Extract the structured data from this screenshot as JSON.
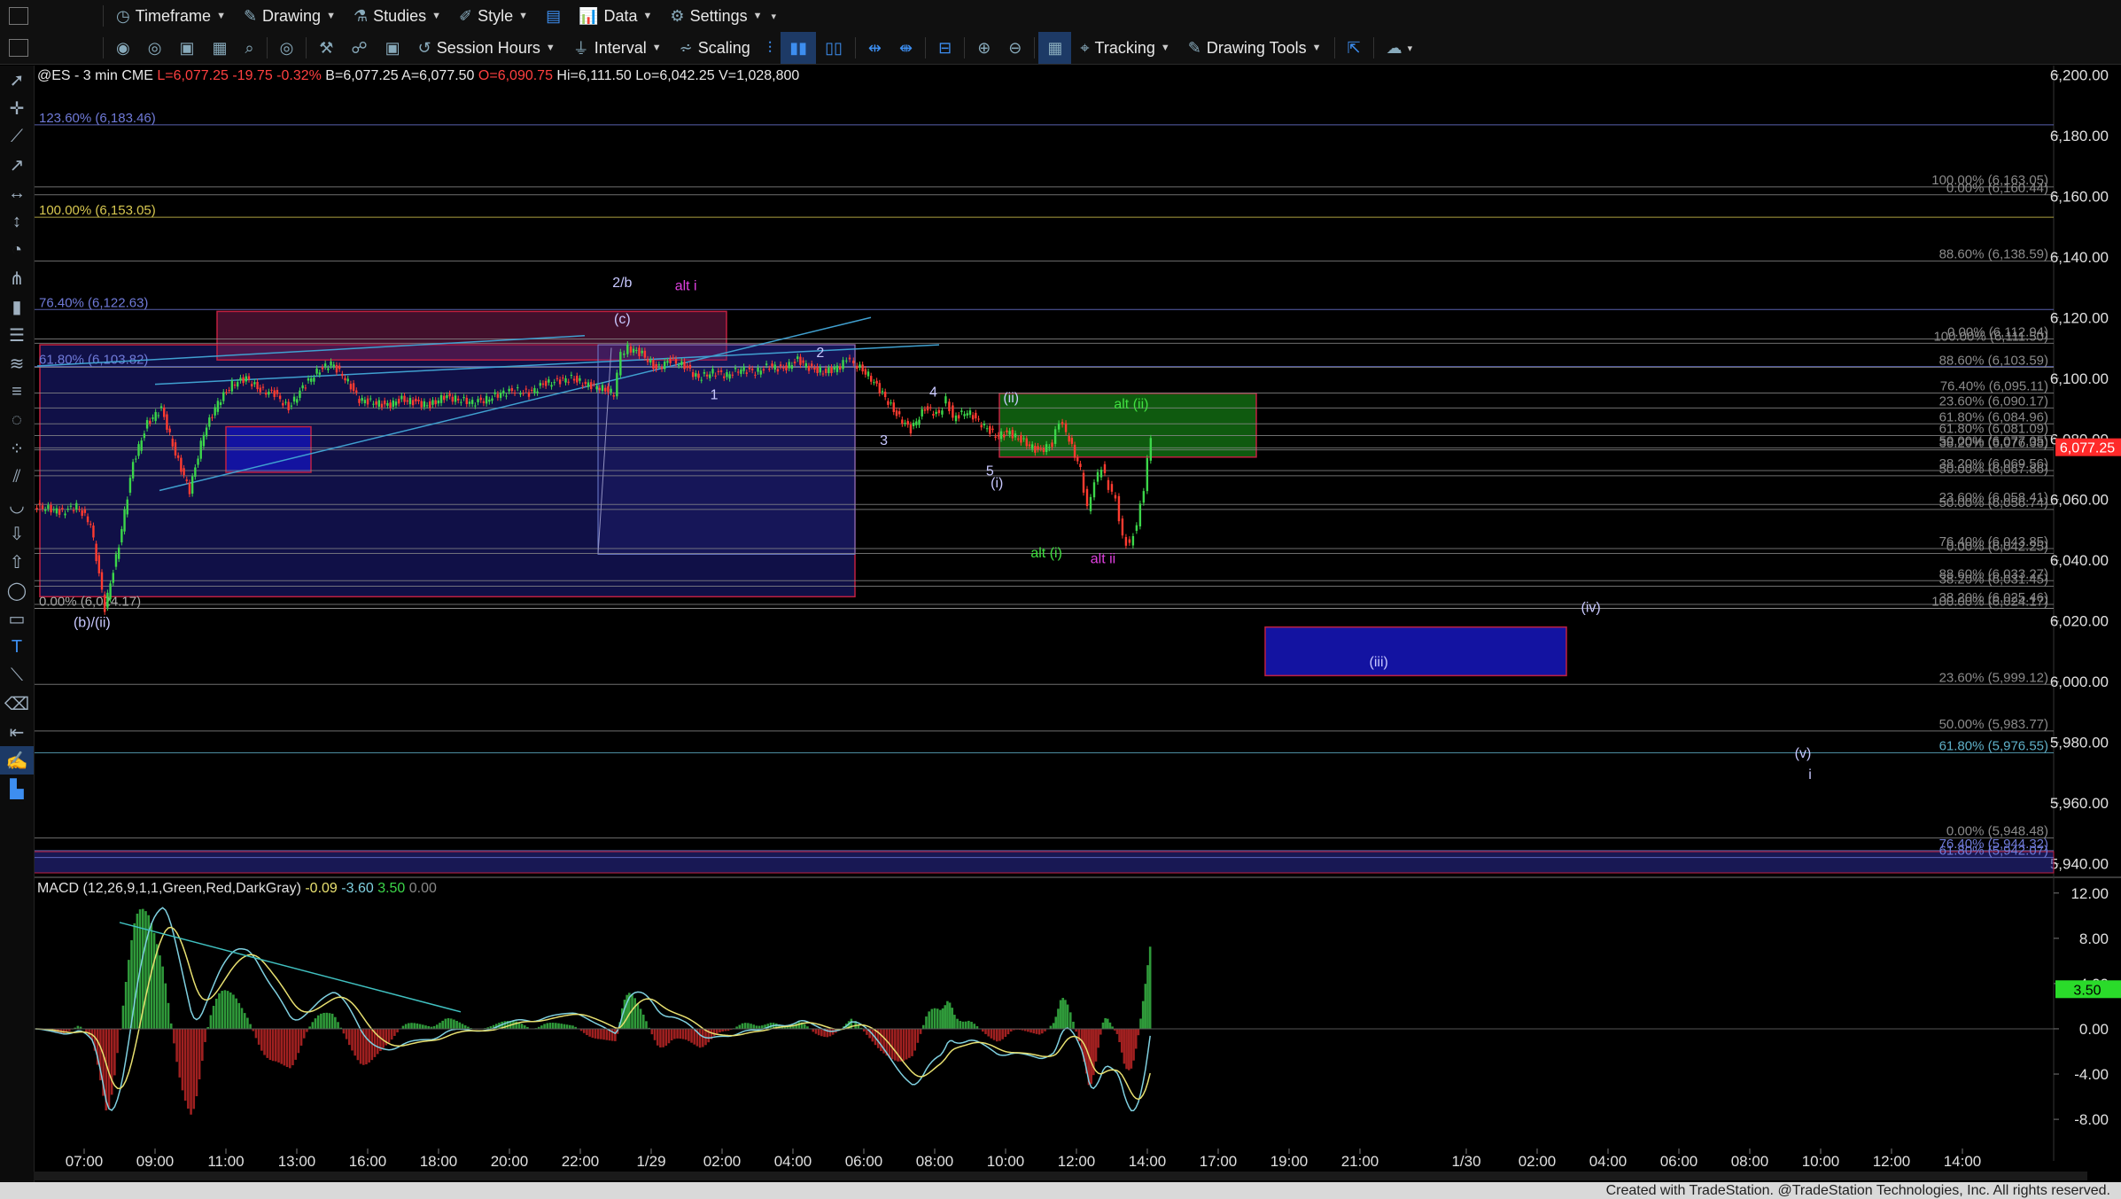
{
  "toolbar1": {
    "timeframe": "Timeframe",
    "drawing": "Drawing",
    "studies": "Studies",
    "style": "Style",
    "data": "Data",
    "settings": "Settings"
  },
  "toolbar2": {
    "session_hours": "Session Hours",
    "interval": "Interval",
    "scaling": "Scaling",
    "tracking": "Tracking",
    "drawing_tools": "Drawing Tools"
  },
  "quote": {
    "symbol": "@ES - 3 min",
    "exchange": "CME",
    "last": "L=6,077.25",
    "chg": "-19.75",
    "pct": "-0.32%",
    "bid": "B=6,077.25",
    "ask": "A=6,077.50",
    "open": "O=6,090.75",
    "high": "Hi=6,111.50",
    "low": "Lo=6,042.25",
    "vol": "V=1,028,800"
  },
  "macd_label": {
    "name": "MACD (12,26,9,1,1,Green,Red,DarkGray)",
    "v1": "-0.09",
    "v2": "-3.60",
    "v3": "3.50",
    "v4": "0.00"
  },
  "price_tag": "6,077.25",
  "macd_tag": "3.50",
  "footer": "Created with TradeStation. @TradeStation Technologies, Inc. All rights reserved.",
  "colors": {
    "background": "#000000",
    "up_candle": "#3cd64a",
    "down_candle": "#ff3b30",
    "price_tag": "#ff2a2a",
    "macd_line": "#7fd0e0",
    "signal_line": "#e8e070",
    "fib_blue": "#6f7ad8",
    "fib_gray": "#8a8a8a"
  },
  "chart_data": [
    {
      "type": "candlestick",
      "title": "@ES - 3 min",
      "x_ticks": [
        "07:00",
        "09:00",
        "11:00",
        "13:00",
        "16:00",
        "18:00",
        "20:00",
        "22:00",
        "1/29",
        "02:00",
        "04:00",
        "06:00",
        "08:00",
        "10:00",
        "12:00",
        "14:00",
        "17:00",
        "19:00",
        "21:00",
        "1/30",
        "02:00",
        "04:00",
        "06:00",
        "08:00",
        "10:00",
        "12:00",
        "14:00"
      ],
      "y_ticks": [
        "6,200.00",
        "6,180.00",
        "6,160.00",
        "6,140.00",
        "6,120.00",
        "6,100.00",
        "6,080.00",
        "6,060.00",
        "6,040.00",
        "6,020.00",
        "6,000.00",
        "5,980.00",
        "5,960.00",
        "5,940.00"
      ],
      "ylim": [
        5937,
        6203
      ],
      "price_path": [
        [
          0,
          6058
        ],
        [
          2,
          6056
        ],
        [
          3,
          6058
        ],
        [
          4,
          6052
        ],
        [
          5,
          6024.17
        ],
        [
          6,
          6045
        ],
        [
          7,
          6072
        ],
        [
          8,
          6085
        ],
        [
          9,
          6090
        ],
        [
          10,
          6075
        ],
        [
          11,
          6063
        ],
        [
          12,
          6082
        ],
        [
          13,
          6092
        ],
        [
          14,
          6098
        ],
        [
          15,
          6100
        ],
        [
          16,
          6096
        ],
        [
          17,
          6095
        ],
        [
          18,
          6090
        ],
        [
          19,
          6097
        ],
        [
          20,
          6102
        ],
        [
          21,
          6105
        ],
        [
          22,
          6100
        ],
        [
          23,
          6093
        ],
        [
          24,
          6092
        ],
        [
          25,
          6091
        ],
        [
          26,
          6093
        ],
        [
          27,
          6092
        ],
        [
          28,
          6091
        ],
        [
          29,
          6094
        ],
        [
          30,
          6093
        ],
        [
          31,
          6092
        ],
        [
          32,
          6093
        ],
        [
          33,
          6095
        ],
        [
          34,
          6096
        ],
        [
          35,
          6095
        ],
        [
          36,
          6098
        ],
        [
          37,
          6099
        ],
        [
          38,
          6100
        ],
        [
          39,
          6098
        ],
        [
          40,
          6097
        ],
        [
          41,
          6095
        ],
        [
          41.5,
          6108
        ],
        [
          42,
          6110
        ],
        [
          43,
          6108
        ],
        [
          44,
          6103
        ],
        [
          45,
          6106
        ],
        [
          46,
          6104
        ],
        [
          47,
          6100
        ],
        [
          48,
          6102
        ],
        [
          49,
          6101
        ],
        [
          50,
          6103
        ],
        [
          51,
          6102
        ],
        [
          52,
          6104
        ],
        [
          53,
          6103
        ],
        [
          54,
          6106
        ],
        [
          55,
          6103
        ],
        [
          56,
          6102
        ],
        [
          57,
          6104
        ],
        [
          57.7,
          6107
        ],
        [
          58,
          6105
        ],
        [
          59,
          6101
        ],
        [
          60,
          6095
        ],
        [
          61,
          6088
        ],
        [
          62,
          6083
        ],
        [
          63,
          6090
        ],
        [
          64,
          6088
        ],
        [
          64.5,
          6093
        ],
        [
          65,
          6087
        ],
        [
          66,
          6089
        ],
        [
          67,
          6085
        ],
        [
          68,
          6081
        ],
        [
          69,
          6082
        ],
        [
          70,
          6079
        ],
        [
          71,
          6076
        ],
        [
          72,
          6078
        ],
        [
          72.5,
          6086
        ],
        [
          73,
          6082
        ],
        [
          74,
          6070
        ],
        [
          74.5,
          6057
        ],
        [
          75,
          6066
        ],
        [
          75.5,
          6071
        ],
        [
          76,
          6064
        ],
        [
          76.5,
          6060
        ],
        [
          77,
          6047
        ],
        [
          77.5,
          6045
        ],
        [
          78,
          6052
        ],
        [
          78.5,
          6064
        ],
        [
          79,
          6081
        ]
      ],
      "fib_levels": [
        {
          "label": "123.60% (6,183.46)",
          "price": 6183.46,
          "side": "left",
          "color": "#6f7ad8"
        },
        {
          "label": "100.00% (6,153.05)",
          "price": 6153.05,
          "side": "left",
          "color": "#d8c850"
        },
        {
          "label": "76.40% (6,122.63)",
          "price": 6122.63,
          "side": "left",
          "color": "#6f7ad8"
        },
        {
          "label": "61.80% (6,103.82)",
          "price": 6103.82,
          "side": "left",
          "color": "#6f7ad8"
        },
        {
          "label": "0.00% (6,024.17)",
          "price": 6024.17,
          "side": "left",
          "color": "#aaaaaa"
        },
        {
          "label": "100.00% (6,163.05)",
          "price": 6163.05,
          "side": "right",
          "color": "#8a8a8a"
        },
        {
          "label": "0.00% (6,160.44)",
          "price": 6160.44,
          "side": "right",
          "color": "#8a8a8a"
        },
        {
          "label": "88.60% (6,138.59)",
          "price": 6138.59,
          "side": "right",
          "color": "#8a8a8a"
        },
        {
          "label": "0.00% (6,112.94)",
          "price": 6112.94,
          "side": "right",
          "color": "#8a8a8a"
        },
        {
          "label": "100.00% (6,111.50)",
          "price": 6111.5,
          "side": "right",
          "color": "#8a8a8a"
        },
        {
          "label": "88.60% (6,103.59)",
          "price": 6103.59,
          "side": "right",
          "color": "#8a8a8a"
        },
        {
          "label": "76.40% (6,095.11)",
          "price": 6095.11,
          "side": "right",
          "color": "#8a8a8a"
        },
        {
          "label": "23.60% (6,090.17)",
          "price": 6090.17,
          "side": "right",
          "color": "#8a8a8a"
        },
        {
          "label": "61.80% (6,084.96)",
          "price": 6084.96,
          "side": "right",
          "color": "#8a8a8a"
        },
        {
          "label": "61.80% (6,081.09)",
          "price": 6081.09,
          "side": "right",
          "color": "#8a8a8a"
        },
        {
          "label": "50.00% (6,077.05)",
          "price": 6077.05,
          "side": "right",
          "color": "#8a8a8a"
        },
        {
          "label": "38.20% (6,076.38)",
          "price": 6076.38,
          "side": "right",
          "color": "#8a8a8a"
        },
        {
          "label": "38.20% (6,069.56)",
          "price": 6069.56,
          "side": "right",
          "color": "#8a8a8a"
        },
        {
          "label": "50.00% (6,067.86)",
          "price": 6067.86,
          "side": "right",
          "color": "#8a8a8a"
        },
        {
          "label": "23.60% (6,058.41)",
          "price": 6058.41,
          "side": "right",
          "color": "#8a8a8a"
        },
        {
          "label": "50.00% (6,056.74)",
          "price": 6056.74,
          "side": "right",
          "color": "#8a8a8a"
        },
        {
          "label": "76.40% (6,043.85)",
          "price": 6043.85,
          "side": "right",
          "color": "#8a8a8a"
        },
        {
          "label": "0.00% (6,042.25)",
          "price": 6042.25,
          "side": "right",
          "color": "#8a8a8a"
        },
        {
          "label": "88.60% (6,033.27)",
          "price": 6033.27,
          "side": "right",
          "color": "#8a8a8a"
        },
        {
          "label": "38.20% (6,031.45)",
          "price": 6031.45,
          "side": "right",
          "color": "#8a8a8a"
        },
        {
          "label": "38.20% (6,025.46)",
          "price": 6025.46,
          "side": "right",
          "color": "#8a8a8a"
        },
        {
          "label": "100.00% (6,024.17)",
          "price": 6024.17,
          "side": "right",
          "color": "#8a8a8a"
        },
        {
          "label": "23.60% (5,999.12)",
          "price": 5999.12,
          "side": "right",
          "color": "#8a8a8a"
        },
        {
          "label": "50.00% (5,983.77)",
          "price": 5983.77,
          "side": "right",
          "color": "#8a8a8a"
        },
        {
          "label": "61.80% (5,976.55)",
          "price": 5976.55,
          "side": "right",
          "color": "#5fb0c8"
        },
        {
          "label": "0.00% (5,948.48)",
          "price": 5948.48,
          "side": "right",
          "color": "#8a8a8a"
        },
        {
          "label": "76.40% (5,944.32)",
          "price": 5944.32,
          "side": "right",
          "color": "#6f7ad8"
        },
        {
          "label": "61.80% (5,942.07)",
          "price": 5942.07,
          "side": "right",
          "color": "#6f7ad8"
        }
      ],
      "wave_labels": [
        {
          "text": "2/b",
          "x": 41.5,
          "price": 6130,
          "color": "#c8c8ff"
        },
        {
          "text": "(c)",
          "x": 41.5,
          "price": 6118,
          "color": "#c8c8ff"
        },
        {
          "text": "alt i",
          "x": 46,
          "price": 6129,
          "color": "#e040e0"
        },
        {
          "text": "1",
          "x": 48,
          "price": 6093,
          "color": "#c8c8ff"
        },
        {
          "text": "2",
          "x": 55.5,
          "price": 6107,
          "color": "#c8c8ff"
        },
        {
          "text": "3",
          "x": 60,
          "price": 6078,
          "color": "#c8c8ff"
        },
        {
          "text": "4",
          "x": 63.5,
          "price": 6094,
          "color": "#c8c8ff"
        },
        {
          "text": "(ii)",
          "x": 69,
          "price": 6092,
          "color": "#c8c8ff"
        },
        {
          "text": "5",
          "x": 67.5,
          "price": 6068,
          "color": "#c8c8ff"
        },
        {
          "text": "(i)",
          "x": 68,
          "price": 6064,
          "color": "#c8c8ff"
        },
        {
          "text": "alt (ii)",
          "x": 77.5,
          "price": 6090,
          "color": "#40e040"
        },
        {
          "text": "alt (i)",
          "x": 71.5,
          "price": 6041,
          "color": "#40e040"
        },
        {
          "text": "alt ii",
          "x": 75.5,
          "price": 6039,
          "color": "#e040e0"
        },
        {
          "text": "(b)/(ii)",
          "x": 4,
          "price": 6018,
          "color": "#c8c8ff"
        },
        {
          "text": "(iv)",
          "x": 110,
          "price": 6023,
          "color": "#c8c8ff"
        },
        {
          "text": "(iii)",
          "x": 95,
          "price": 6005,
          "color": "#c8c8ff"
        },
        {
          "text": "(v)",
          "x": 125,
          "price": 5975,
          "color": "#c8c8ff"
        },
        {
          "text": "i",
          "x": 125.5,
          "price": 5968,
          "color": "#c8c8ff"
        }
      ]
    },
    {
      "type": "bar",
      "title": "MACD (12,26,9,1,1,Green,Red,DarkGray)",
      "y_ticks": [
        "12.00",
        "8.00",
        "4.00",
        "0.00",
        "-4.00",
        "-8.00"
      ],
      "ylim": [
        -10.5,
        13
      ]
    }
  ]
}
